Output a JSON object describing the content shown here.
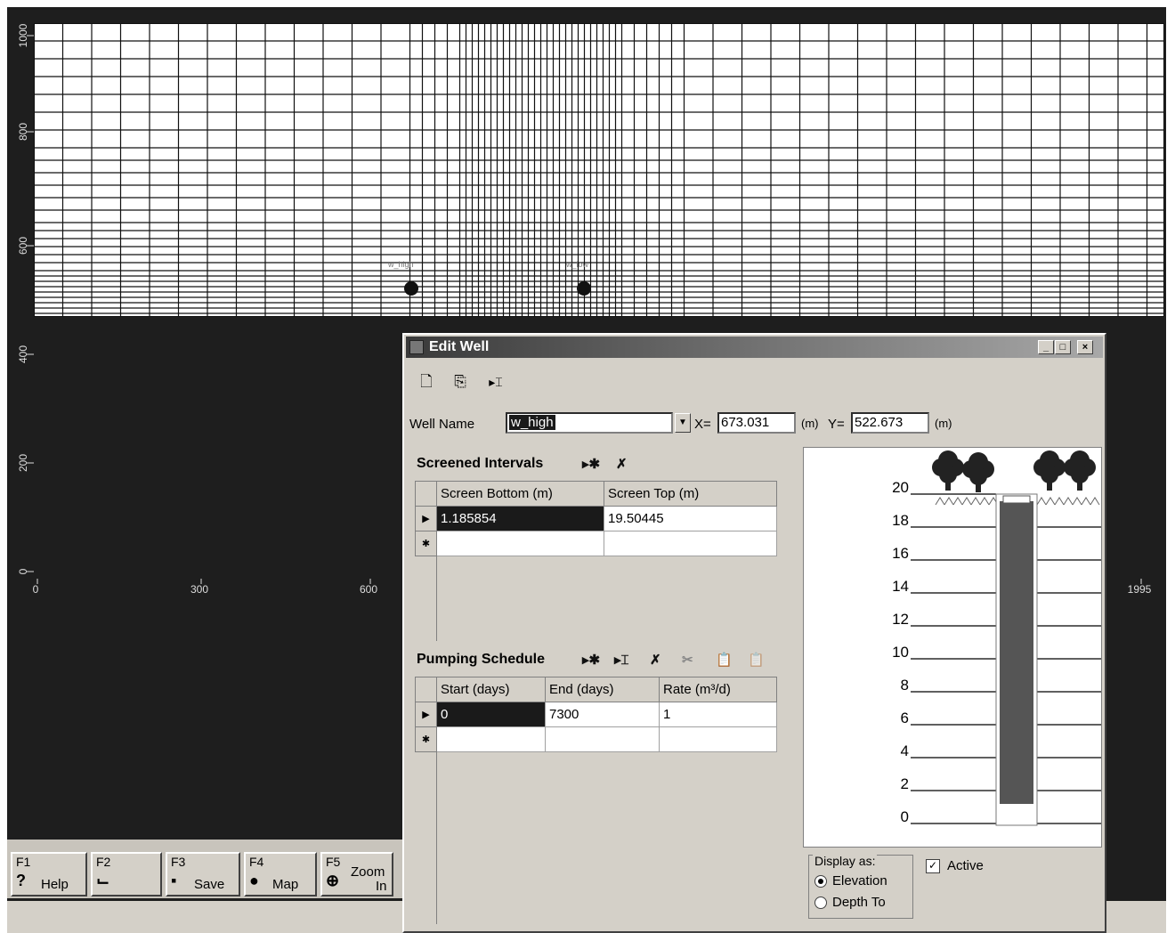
{
  "plot": {
    "y_ticks": [
      "1000",
      "800",
      "600",
      "400",
      "200",
      "0"
    ],
    "x_ticks": [
      "0",
      "300",
      "600",
      "1995"
    ]
  },
  "wells": {
    "left_label": "w_high",
    "right_label": "w_low"
  },
  "fkeys": [
    {
      "key": "F1",
      "label": "Help",
      "icon": "help-icon",
      "glyph": "?"
    },
    {
      "key": "F2",
      "label": "",
      "icon": "chart-icon",
      "glyph": "⌙"
    },
    {
      "key": "F3",
      "label": "Save",
      "icon": "save-icon",
      "glyph": "▪"
    },
    {
      "key": "F4",
      "label": "Map",
      "icon": "map-icon",
      "glyph": "●"
    },
    {
      "key": "F5",
      "label": "Zoom In",
      "line1": "Zoom",
      "line2": "In",
      "icon": "zoom-icon",
      "glyph": "⊕"
    }
  ],
  "dialog": {
    "title": "Edit Well",
    "window_buttons": {
      "minimize": "_",
      "maximize": "□",
      "close": "×"
    },
    "toolbar": {
      "new_glyph": "🗋",
      "copy_glyph": "⎘",
      "insert_glyph": "▸⌶"
    },
    "well_name_label": "Well Name",
    "well_name_value": "w_high",
    "x_label": "X=",
    "x_value": "673.031",
    "x_unit": "(m)",
    "y_label": "Y=",
    "y_value": "522.673",
    "y_unit": "(m)",
    "screened": {
      "title": "Screened Intervals",
      "add_glyph": "▸✱",
      "delete_glyph": "✗",
      "columns": [
        "Screen Bottom (m)",
        "Screen Top (m)"
      ],
      "rows": [
        [
          "1.185854",
          "19.50445"
        ]
      ],
      "new_row_marker": "✱",
      "current_marker": "▶"
    },
    "pumping": {
      "title": "Pumping Schedule",
      "add_glyph": "▸✱",
      "insert_glyph": "▸⌶",
      "delete_glyph": "✗",
      "cut_glyph": "✂",
      "paste_glyph": "📋",
      "paste2_glyph": "📋",
      "columns": [
        "Start (days)",
        "End (days)",
        "Rate (m³/d)"
      ],
      "rows": [
        [
          "0",
          "7300",
          "1"
        ]
      ],
      "new_row_marker": "✱",
      "current_marker": "▶"
    },
    "well_view": {
      "elev_labels": [
        "20",
        "18",
        "16",
        "14",
        "12",
        "10",
        "8",
        "6",
        "4",
        "2",
        "0"
      ]
    },
    "display_as": {
      "legend": "Display as:",
      "options": [
        "Elevation",
        "Depth To"
      ],
      "selected": "Elevation"
    },
    "active": {
      "label": "Active",
      "checked": true,
      "check_glyph": "✓"
    }
  }
}
